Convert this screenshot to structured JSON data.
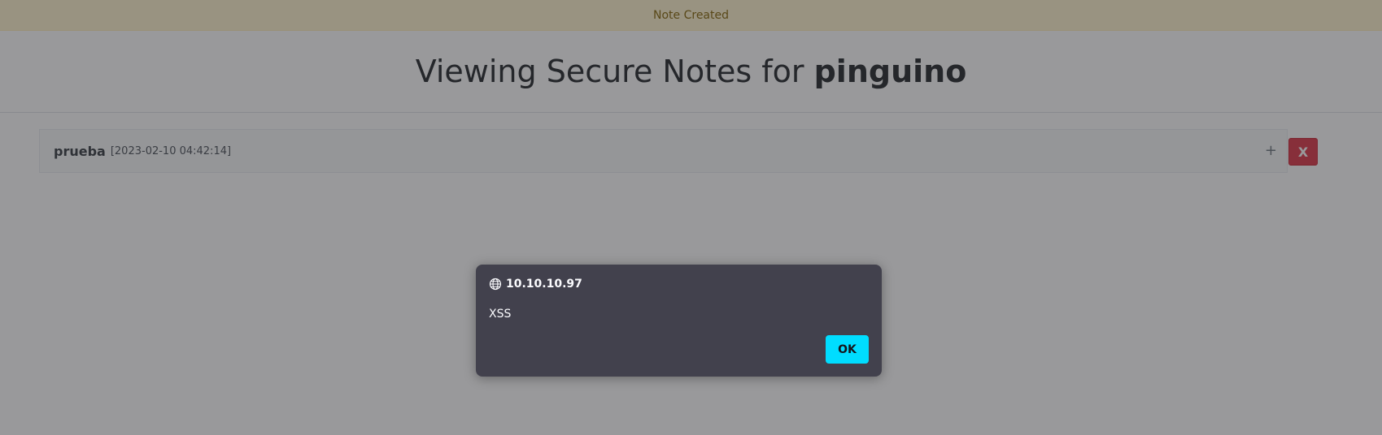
{
  "notice": {
    "text": "Note Created"
  },
  "header": {
    "title_prefix": "Viewing Secure Notes for ",
    "username": "pinguino"
  },
  "notes": [
    {
      "title": "prueba",
      "date": "[2023-02-10 04:42:14]",
      "expand_label": "+",
      "delete_label": "X"
    }
  ],
  "dialog": {
    "origin": "10.10.10.97",
    "origin_icon": "globe-icon",
    "message": "XSS",
    "ok_label": "OK"
  },
  "colors": {
    "notice_bg": "#fff3cd",
    "notice_text": "#856404",
    "delete_button": "#dc3545",
    "dialog_bg": "#42414d",
    "ok_button": "#00ddff"
  }
}
